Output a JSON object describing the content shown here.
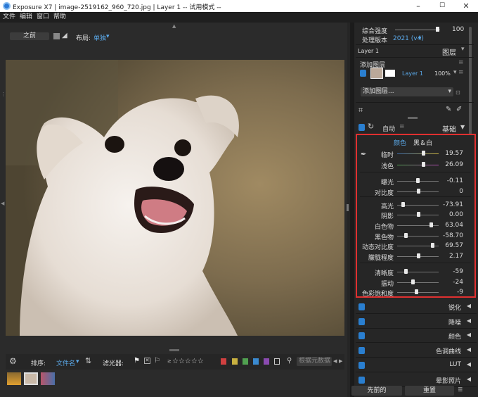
{
  "window": {
    "title": "Exposure X7 | image-2519162_960_720.jpg | Layer 1 -- 试用模式 --",
    "min_glyph": "–",
    "max_glyph": "☐",
    "close_glyph": "✕"
  },
  "menu": [
    "文件",
    "编辑",
    "窗口",
    "帮助"
  ],
  "toolbar": {
    "before_label": "之前",
    "layout_label": "布局:",
    "layout_value": "单独",
    "dropdown_glyph": "▾"
  },
  "filter_bar": {
    "sort_label": "排序:",
    "sort_value": "文件名",
    "filter_label": "滤光器:",
    "stars": "☆☆☆☆☆",
    "metadata_placeholder": "根据元数据",
    "color_labels": [
      "#d04040",
      "#c8b040",
      "#50a050",
      "#3a8ad0",
      "#8a4ab0"
    ]
  },
  "right_panel": {
    "blend_label": "综合强度",
    "blend_value": "100",
    "process_label": "处理版本",
    "process_value": "2021 (v4)",
    "layer_name": "Layer 1",
    "layers_title": "图层",
    "add_layer_title": "添加图层",
    "layer_item_name": "Layer 1",
    "layer_item_opacity": "100%",
    "add_layer_dropdown": "添加图层...",
    "auto_label": "自动",
    "basic_title": "基础",
    "tab_color": "颜色",
    "tab_bw": "黑＆白",
    "sliders": [
      {
        "name": "临时",
        "value": "19.57",
        "pos": 0.62
      },
      {
        "name": "浅色",
        "value": "26.09",
        "pos": 0.63
      },
      {
        "name": "曝光",
        "value": "-0.11",
        "pos": 0.49
      },
      {
        "name": "对比度",
        "value": "0",
        "pos": 0.5
      },
      {
        "name": "高光",
        "value": "-73.91",
        "pos": 0.13
      },
      {
        "name": "阴影",
        "value": "0.00",
        "pos": 0.5
      },
      {
        "name": "白色物",
        "value": "63.04",
        "pos": 0.81
      },
      {
        "name": "黑色物",
        "value": "-58.70",
        "pos": 0.2
      },
      {
        "name": "动态对比度",
        "value": "69.57",
        "pos": 0.84
      },
      {
        "name": "朦胧程度",
        "value": "2.17",
        "pos": 0.51
      },
      {
        "name": "清晰度",
        "value": "-59",
        "pos": 0.2
      },
      {
        "name": "振动",
        "value": "-24",
        "pos": 0.38
      },
      {
        "name": "色彩饱和度",
        "value": "-9",
        "pos": 0.45
      }
    ],
    "panels": [
      "锐化",
      "降噪",
      "颜色",
      "色调曲线",
      "LUT",
      "晕影照片"
    ],
    "prev_button": "先前的",
    "reset_button": "重置"
  }
}
